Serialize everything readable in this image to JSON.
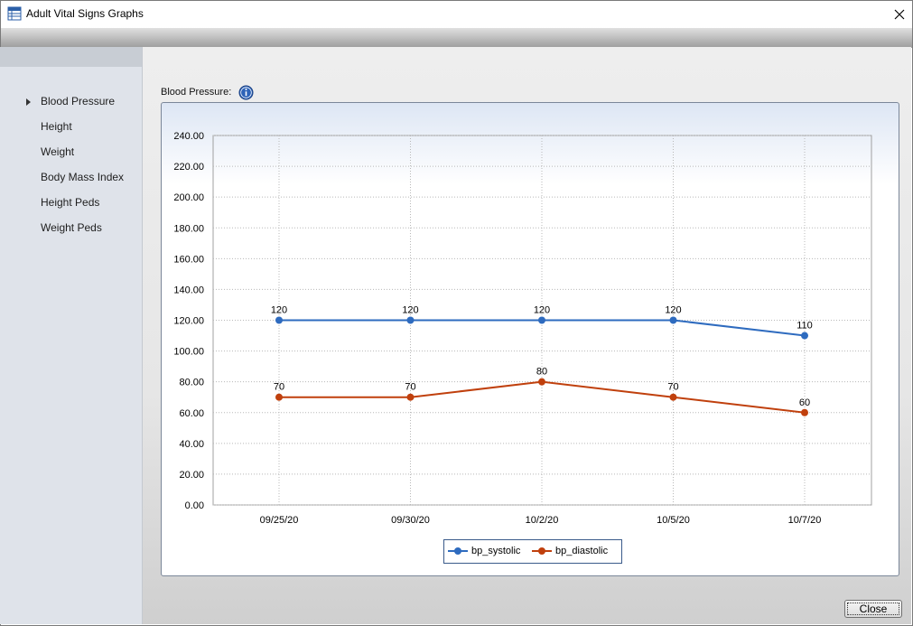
{
  "window": {
    "title": "Adult Vital Signs Graphs",
    "icon": "table-icon",
    "close_icon": "close-icon"
  },
  "sidebar": {
    "items": [
      {
        "label": "Blood Pressure",
        "selected": true
      },
      {
        "label": "Height"
      },
      {
        "label": "Weight"
      },
      {
        "label": "Body Mass Index"
      },
      {
        "label": "Height Peds"
      },
      {
        "label": "Weight Peds"
      }
    ]
  },
  "main": {
    "section_label": "Blood Pressure:",
    "info_icon": "info-icon"
  },
  "footer": {
    "close_label": "Close"
  },
  "colors": {
    "systolic": "#2e6bbf",
    "diastolic": "#c0400d",
    "grid": "#b8b8b8"
  },
  "chart_data": {
    "type": "line",
    "categories": [
      "09/25/20",
      "09/30/20",
      "10/2/20",
      "10/5/20",
      "10/7/20"
    ],
    "series": [
      {
        "name": "bp_systolic",
        "values": [
          120,
          120,
          120,
          120,
          110
        ],
        "labels": [
          "120",
          "120",
          "120",
          "120",
          "110"
        ]
      },
      {
        "name": "bp_diastolic",
        "values": [
          70,
          70,
          80,
          70,
          60
        ],
        "labels": [
          "70",
          "70",
          "80",
          "70",
          "60"
        ]
      }
    ],
    "ylim": [
      0,
      240
    ],
    "yticks": [
      "0.00",
      "20.00",
      "40.00",
      "60.00",
      "80.00",
      "100.00",
      "120.00",
      "140.00",
      "160.00",
      "180.00",
      "200.00",
      "220.00",
      "240.00"
    ],
    "grid": true,
    "legend_position": "bottom-center"
  }
}
